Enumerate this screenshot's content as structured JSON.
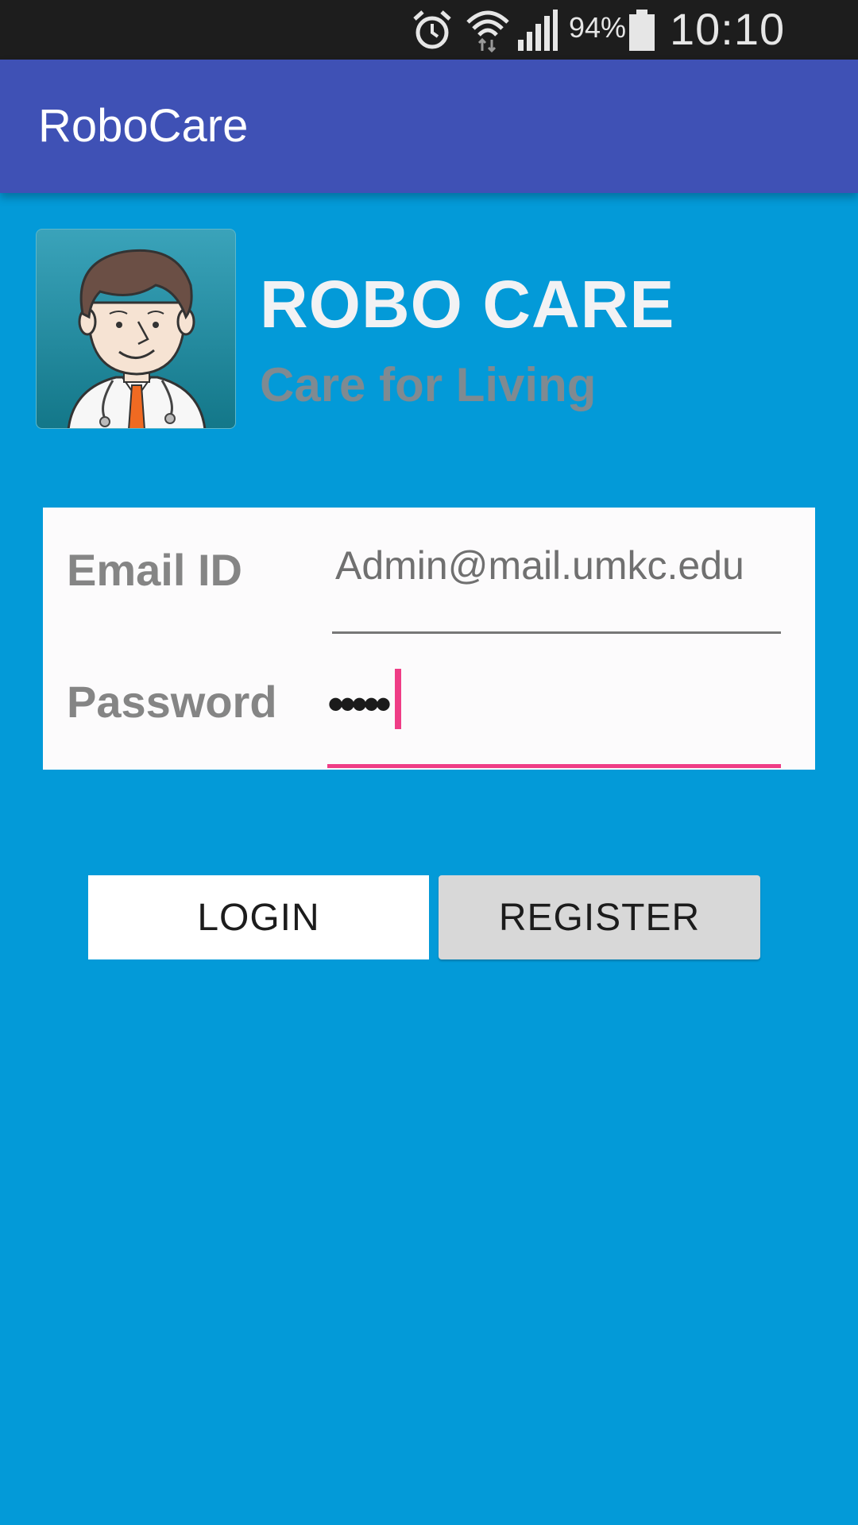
{
  "status_bar": {
    "battery_percent": "94%",
    "time": "10:10 PM",
    "icons": [
      "alarm-icon",
      "wifi-icon",
      "signal-icon",
      "battery-icon"
    ]
  },
  "app_bar": {
    "title": "RoboCare"
  },
  "brand": {
    "title": "ROBO CARE",
    "subtitle": "Care for Living",
    "logo_icon": "doctor-avatar-icon"
  },
  "form": {
    "email_label": "Email ID",
    "email_value": "Admin@mail.umkc.edu",
    "password_label": "Password",
    "password_value": "•••••"
  },
  "buttons": {
    "login": "LOGIN",
    "register": "REGISTER"
  },
  "colors": {
    "background": "#039ad8",
    "app_bar": "#3f51b5",
    "accent": "#ef3d86"
  }
}
